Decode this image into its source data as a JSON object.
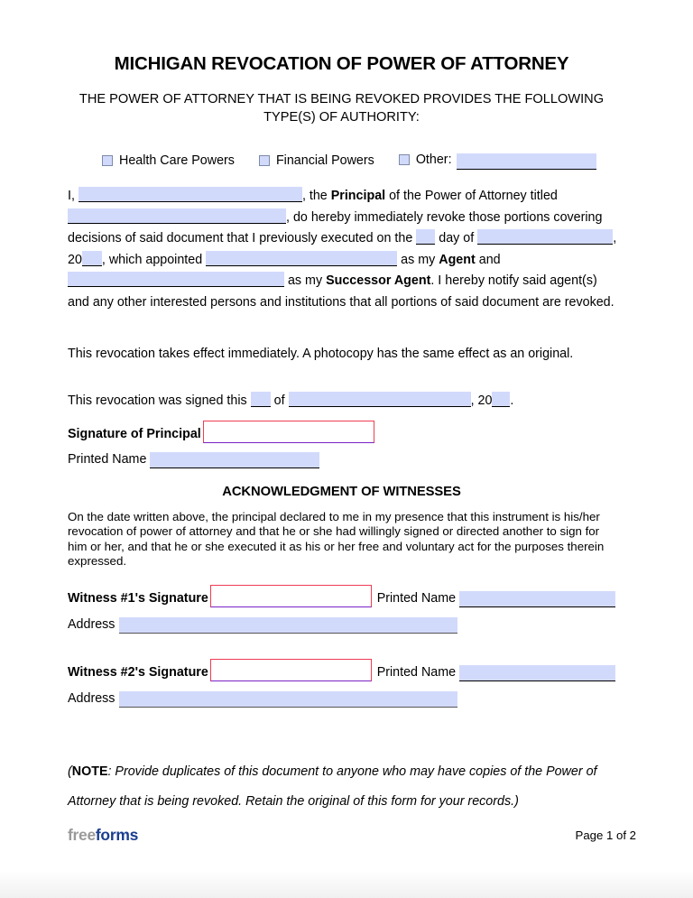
{
  "document": {
    "title": "MICHIGAN REVOCATION OF POWER OF ATTORNEY",
    "subtitle": "THE POWER OF ATTORNEY THAT IS BEING REVOKED PROVIDES THE FOLLOWING TYPE(S) OF AUTHORITY:"
  },
  "authority_types": {
    "health_care_label": "Health Care Powers",
    "financial_label": "Financial Powers",
    "other_label": "Other:",
    "other_value": ""
  },
  "revocation_paragraph": {
    "t1": "I,",
    "principal_name": "",
    "t2": ", the ",
    "principal_bold": "Principal",
    "t3": " of the Power of Attorney titled",
    "poa_title": "",
    "t4": ", do hereby immediately revoke those portions covering",
    "t5": "decisions of said document that I previously executed on the",
    "day_value": "",
    "t6": "day of",
    "month_value": "",
    "t7": ",",
    "t8": "20",
    "year_value": "",
    "t9": ", which appointed",
    "agent_name": "",
    "t10": " as my ",
    "agent_bold": "Agent",
    "t11": " and",
    "successor_name": "",
    "t12": " as my ",
    "successor_bold": "Successor Agent",
    "t13": ". I hereby notify said agent(s)",
    "t14": "and any other interested persons and institutions that all portions of said document are revoked."
  },
  "effect_paragraph": "This revocation takes effect immediately. A photocopy has the same effect as an original.",
  "signing_line": {
    "t1": "This revocation was signed this",
    "day_value": "",
    "t2": "of",
    "month_value": "",
    "t3": ", 20",
    "year_value": "",
    "t4": "."
  },
  "principal_signature": {
    "label": "Signature of Principal",
    "value": ""
  },
  "principal_printed_name": {
    "label": "Printed Name",
    "value": ""
  },
  "witnesses": {
    "heading": "ACKNOWLEDGMENT OF WITNESSES",
    "statement": "On the date written above, the principal declared to me in my presence that this instrument is his/her revocation of power of attorney and that he or she had willingly signed or directed another to sign for him or her, and that he or she executed it as his or her free and voluntary act for the purposes therein expressed.",
    "entries": [
      {
        "signature_label": "Witness #1's Signature",
        "signature_value": "",
        "printed_name_label": "Printed Name",
        "printed_name_value": "",
        "address_label": "Address",
        "address_value": ""
      },
      {
        "signature_label": "Witness #2's Signature",
        "signature_value": "",
        "printed_name_label": "Printed Name",
        "printed_name_value": "",
        "address_label": "Address",
        "address_value": ""
      }
    ]
  },
  "note": {
    "open_paren": "(",
    "bold": "NOTE",
    "line1": ": Provide duplicates of this document to anyone who may have copies of the Power of",
    "line2": "Attorney that is being revoked. Retain the original of this form for your records.)"
  },
  "footer": {
    "logo_free": "free",
    "logo_forms": "forms",
    "page_number": "Page 1 of 2"
  },
  "colors": {
    "field_fill": "#d2dafc",
    "signature_border": "#ef3c52",
    "signature_underline": "#7a22c7",
    "logo_free": "#9a9a9a",
    "logo_forms": "#1a3f8f"
  }
}
